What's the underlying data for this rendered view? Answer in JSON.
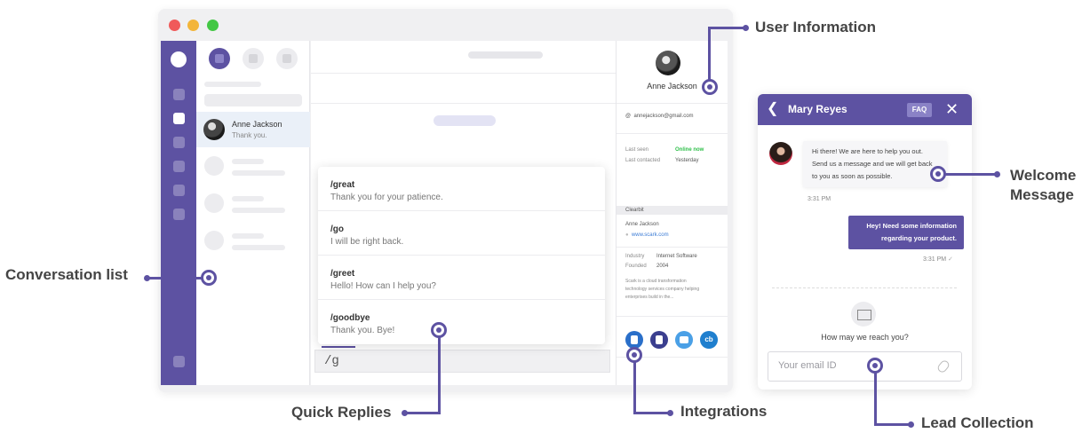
{
  "callouts": {
    "user_information": "User Information",
    "welcome_message_line1": "Welcome",
    "welcome_message_line2": "Message",
    "conversation_list": "Conversation list",
    "quick_replies": "Quick Replies",
    "integrations": "Integrations",
    "lead_collection": "Lead Collection"
  },
  "conversation_list": {
    "active": {
      "name": "Anne Jackson",
      "message": "Thank you."
    }
  },
  "quick_replies": [
    {
      "command": "/great",
      "text": "Thank you for your patience."
    },
    {
      "command": "/go",
      "text": "I will be right back."
    },
    {
      "command": "/greet",
      "text": "Hello! How can I help you?"
    },
    {
      "command": "/goodbye",
      "text": "Thank you. Bye!"
    }
  ],
  "composer": {
    "value": "/g"
  },
  "user_panel": {
    "name": "Anne Jackson",
    "email": "annejackson@gmail.com",
    "last_seen_label": "Last seen",
    "last_seen_value": "Online now",
    "last_contacted_label": "Last contacted",
    "last_contacted_value": "Yesterday",
    "section_title": "Clearbit",
    "company_person": "Anne Jackson",
    "website": "www.scark.com",
    "industry_label": "Industry",
    "industry_value": "Internet Software",
    "founded_label": "Founded",
    "founded_value": "2004",
    "description_line1": "Scark is a cloud transformation",
    "description_line2": "technology services company helping",
    "description_line3": "enterprises build in the...",
    "integration_cb": "cb"
  },
  "widget": {
    "title": "Mary Reyes",
    "faq": "FAQ",
    "welcome_line1": "Hi there! We are here to help you out.",
    "welcome_line2": "Send us a message and we will get back",
    "welcome_line3": "to you as soon as possible.",
    "time1": "3:31 PM",
    "user_msg_line1": "Hey! Need some information",
    "user_msg_line2": "regarding your product.",
    "time2": "3:31 PM",
    "reach_prompt": "How may we reach you?",
    "email_placeholder": "Your email ID"
  },
  "colors": {
    "brand": "#5d52a2",
    "online": "#2fbf4a",
    "link": "#3a7bd5"
  }
}
